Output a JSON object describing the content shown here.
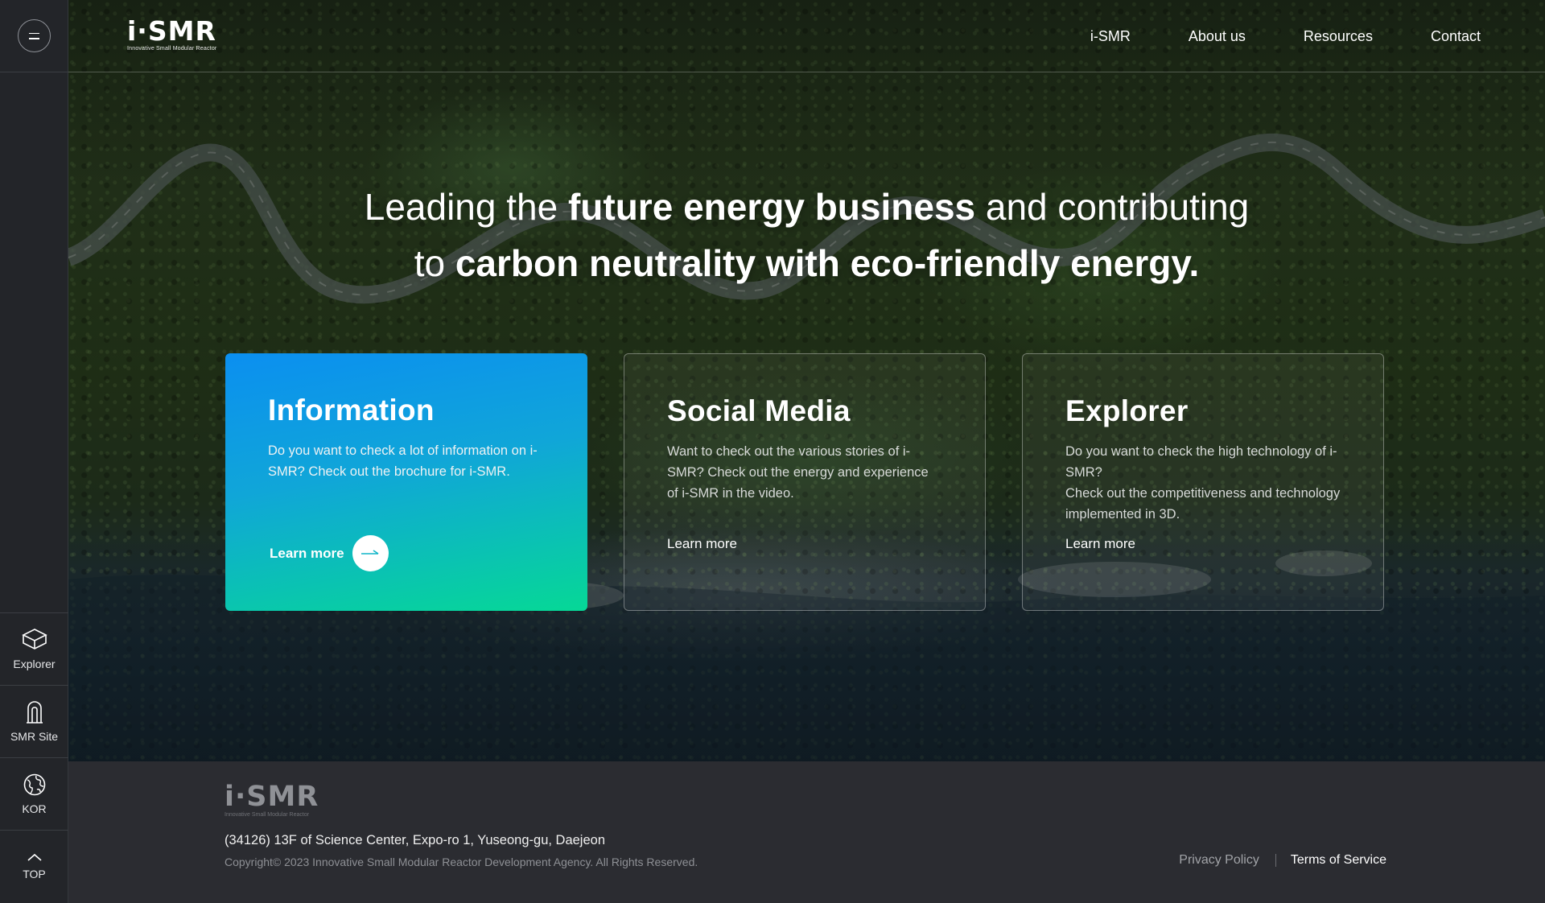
{
  "brand": {
    "wordmark": "i·SMR",
    "tagline": "Innovative Small Modular Reactor"
  },
  "nav": {
    "items": [
      "i-SMR",
      "About us",
      "Resources",
      "Contact"
    ]
  },
  "rail": {
    "menu_icon": "hamburger-icon",
    "items": [
      {
        "label": "Explorer",
        "icon": "cube-icon"
      },
      {
        "label": "SMR Site",
        "icon": "reactor-icon"
      },
      {
        "label": "KOR",
        "icon": "globe-icon"
      },
      {
        "label": "TOP",
        "icon": "chevron-up-icon"
      }
    ]
  },
  "hero": {
    "line1_light_a": "Leading the ",
    "line1_bold": "future energy business",
    "line1_light_b": " and contributing",
    "line2_light": "to ",
    "line2_bold": "carbon neutrality with eco-friendly energy."
  },
  "cards": [
    {
      "title": "Information",
      "body": "Do you want to check a lot of information on i-SMR? Check out the brochure for i-SMR.",
      "link": "Learn more",
      "accent": "#0b8ff0"
    },
    {
      "title": "Social Media",
      "body": "Want to check out the various stories of i-SMR? Check out the energy and experience of i-SMR in the video.",
      "link": "Learn more"
    },
    {
      "title": "Explorer",
      "body_line1": "Do you want to check the high technology of i-SMR?",
      "body_line2": "Check out the competitiveness and technology implemented in 3D.",
      "link": "Learn more"
    }
  ],
  "footer": {
    "address": "(34126) 13F of Science Center, Expo-ro 1, Yuseong-gu, Daejeon",
    "copyright": "Copyright© 2023 Innovative Small Modular Reactor Development Agency. All Rights Reserved.",
    "privacy": "Privacy Policy",
    "terms": "Terms of Service"
  },
  "colors": {
    "card_gradient_start": "#0b8ff0",
    "card_gradient_end": "#06d896",
    "rail_bg": "#232529",
    "footer_bg": "#2b2c31"
  }
}
